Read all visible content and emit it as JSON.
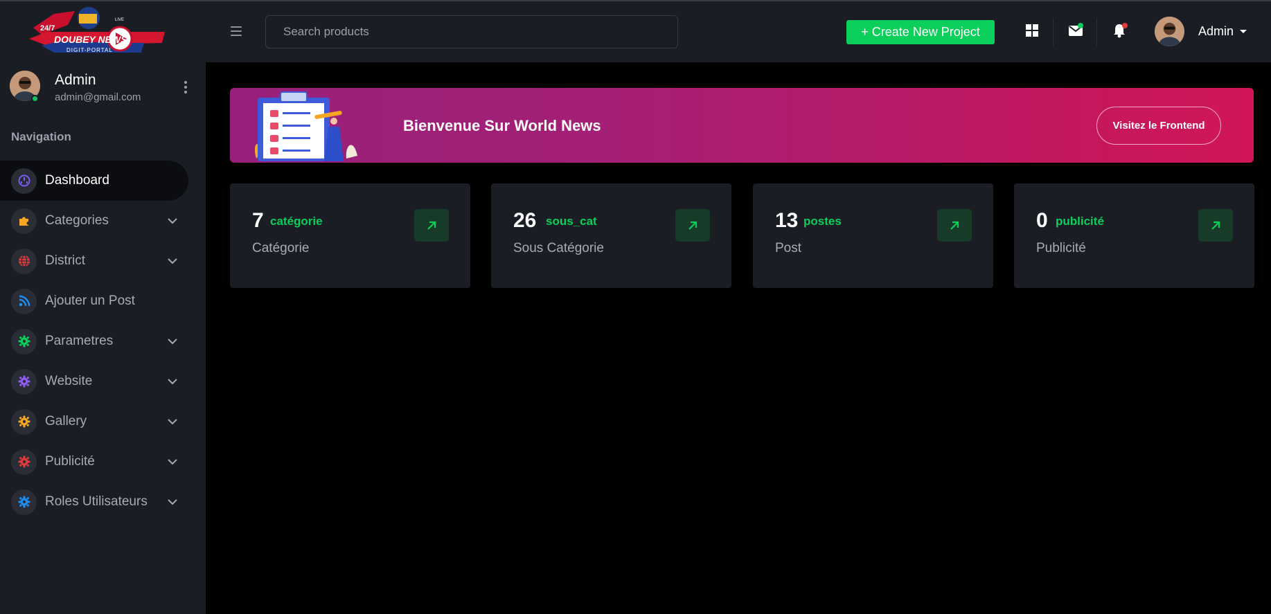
{
  "brand": {
    "logo_alt": "Doubey News Digit-Portal",
    "logo_line1": "24/7",
    "logo_line2": "DOUBEY NEWS",
    "logo_line3": "DIGIT-PORTAL",
    "logo_live": "LIVE"
  },
  "user": {
    "name": "Admin",
    "email": "admin@gmail.com"
  },
  "sidebar": {
    "nav_title": "Navigation",
    "items": [
      {
        "label": "Dashboard",
        "icon": "dashboard-icon",
        "color": "#7b5cf0",
        "active": true,
        "expandable": false
      },
      {
        "label": "Categories",
        "icon": "puzzle-icon",
        "color": "#f5a623",
        "active": false,
        "expandable": true
      },
      {
        "label": "District",
        "icon": "globe-icon",
        "color": "#e23b3b",
        "active": false,
        "expandable": true
      },
      {
        "label": "Ajouter un Post",
        "icon": "rss-icon",
        "color": "#1f8ef1",
        "active": false,
        "expandable": false
      },
      {
        "label": "Parametres",
        "icon": "gear-icon",
        "color": "#0acf5a",
        "active": false,
        "expandable": true
      },
      {
        "label": "Website",
        "icon": "gear-icon",
        "color": "#8e5cf0",
        "active": false,
        "expandable": true
      },
      {
        "label": "Gallery",
        "icon": "gear-icon",
        "color": "#f5a623",
        "active": false,
        "expandable": true
      },
      {
        "label": "Publicité",
        "icon": "gear-icon",
        "color": "#e23b3b",
        "active": false,
        "expandable": true
      },
      {
        "label": "Roles Utilisateurs",
        "icon": "gear-icon",
        "color": "#1f8ef1",
        "active": false,
        "expandable": true
      }
    ]
  },
  "header": {
    "search_placeholder": "Search products",
    "create_button": "+ Create New Project",
    "admin_label": "Admin",
    "mail_badge_color": "#0acf5a",
    "bell_badge_color": "#e23b3b"
  },
  "banner": {
    "title": "Bienvenue Sur World News",
    "button": "Visitez le Frontend"
  },
  "stats": [
    {
      "value": "7",
      "tag": "catégorie",
      "label": "Catégorie"
    },
    {
      "value": "26",
      "tag": "sous_cat",
      "label": "Sous Catégorie"
    },
    {
      "value": "13",
      "tag": "postes",
      "label": "Post"
    },
    {
      "value": "0",
      "tag": "publicité",
      "label": "Publicité"
    }
  ],
  "colors": {
    "accent_green": "#0acf5a",
    "sidebar_bg": "#1b1d24",
    "page_bg": "#000000"
  }
}
